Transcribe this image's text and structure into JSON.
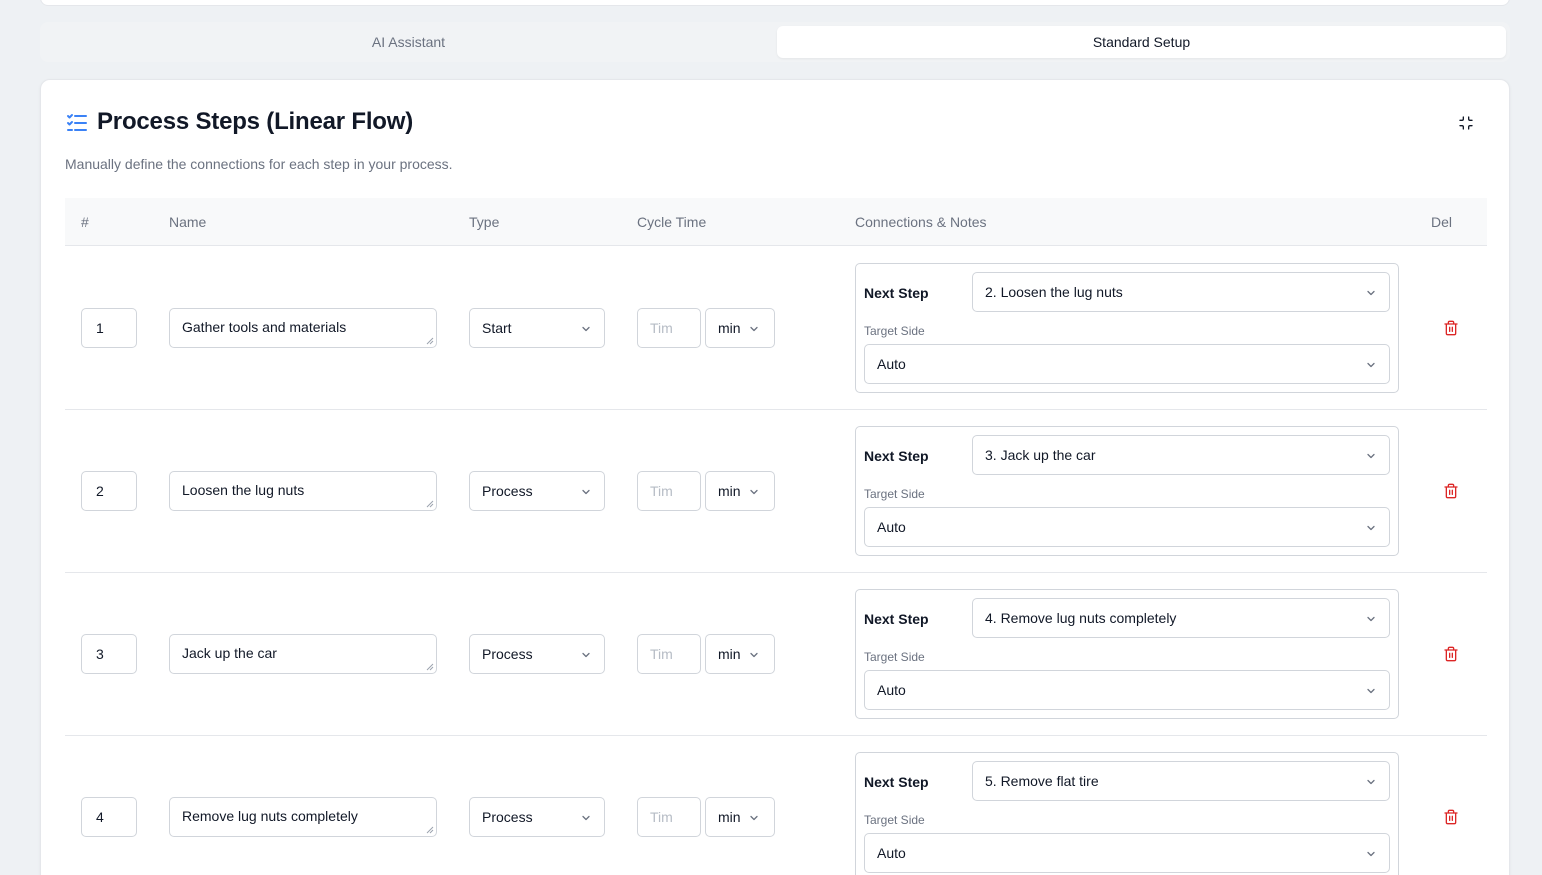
{
  "tabs": [
    {
      "label": "AI Assistant",
      "active": false
    },
    {
      "label": "Standard Setup",
      "active": true
    }
  ],
  "card": {
    "title": "Process Steps (Linear Flow)",
    "description": "Manually define the connections for each step in your process."
  },
  "table": {
    "headers": {
      "num": "#",
      "name": "Name",
      "type": "Type",
      "cycle_time": "Cycle Time",
      "connections": "Connections & Notes",
      "del": "Del"
    }
  },
  "labels": {
    "next_step": "Next Step",
    "target_side": "Target Side",
    "time_placeholder": "Tim"
  },
  "rows": [
    {
      "num": "1",
      "name": "Gather tools and materials",
      "type": "Start",
      "unit": "min",
      "next_step": "2. Loosen the lug nuts",
      "target_side": "Auto"
    },
    {
      "num": "2",
      "name": "Loosen the lug nuts",
      "type": "Process",
      "unit": "min",
      "next_step": "3. Jack up the car",
      "target_side": "Auto"
    },
    {
      "num": "3",
      "name": "Jack up the car",
      "type": "Process",
      "unit": "min",
      "next_step": "4. Remove lug nuts completely",
      "target_side": "Auto"
    },
    {
      "num": "4",
      "name": "Remove lug nuts completely",
      "type": "Process",
      "unit": "min",
      "next_step": "5. Remove flat tire",
      "target_side": "Auto"
    }
  ],
  "colors": {
    "accent": "#3b82f6",
    "delete": "#dc2626"
  },
  "icons": {
    "title": "list-checks-icon",
    "collapse": "minimize-icon",
    "chevron": "chevron-down-icon",
    "delete": "trash-icon"
  }
}
